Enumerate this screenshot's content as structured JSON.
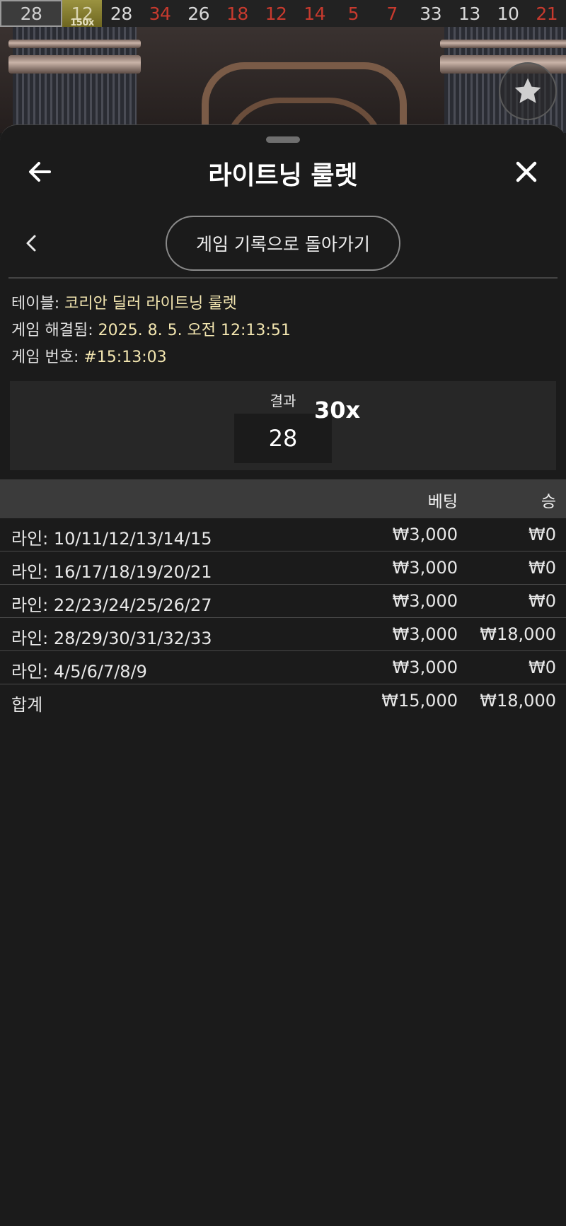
{
  "history_strip": [
    {
      "value": "28",
      "color": "gray"
    },
    {
      "value": "12",
      "color": "lightning",
      "multiplier": "150x"
    },
    {
      "value": "28",
      "color": "white"
    },
    {
      "value": "34",
      "color": "red"
    },
    {
      "value": "26",
      "color": "white"
    },
    {
      "value": "18",
      "color": "red"
    },
    {
      "value": "12",
      "color": "red"
    },
    {
      "value": "14",
      "color": "red"
    },
    {
      "value": "5",
      "color": "red"
    },
    {
      "value": "7",
      "color": "red"
    },
    {
      "value": "33",
      "color": "white"
    },
    {
      "value": "13",
      "color": "white"
    },
    {
      "value": "10",
      "color": "white"
    },
    {
      "value": "21",
      "color": "red"
    }
  ],
  "sheet": {
    "title": "라이트닝 룰렛",
    "back_to_history": "게임 기록으로 돌아가기"
  },
  "info": {
    "table_label": "테이블:",
    "table_value": "코리안 딜러 라이트닝 룰렛",
    "resolved_label": "게임 해결됨:",
    "resolved_value": "2025. 8. 5. 오전 12:13:51",
    "number_label": "게임 번호:",
    "number_value": "#15:13:03"
  },
  "result": {
    "label": "결과",
    "number": "28",
    "multiplier": "30x"
  },
  "bets": {
    "header_bet": "베팅",
    "header_win": "승",
    "rows": [
      {
        "name": "라인: 10/11/12/13/14/15",
        "bet": "₩3,000",
        "win": "₩0"
      },
      {
        "name": "라인: 16/17/18/19/20/21",
        "bet": "₩3,000",
        "win": "₩0"
      },
      {
        "name": "라인: 22/23/24/25/26/27",
        "bet": "₩3,000",
        "win": "₩0"
      },
      {
        "name": "라인: 28/29/30/31/32/33",
        "bet": "₩3,000",
        "win": "₩18,000"
      },
      {
        "name": "라인: 4/5/6/7/8/9",
        "bet": "₩3,000",
        "win": "₩0"
      }
    ],
    "total_label": "합계",
    "total_bet": "₩15,000",
    "total_win": "₩18,000"
  },
  "colors": {
    "red_number": "#c73a2e",
    "lightning_gold": "#9b9340",
    "info_value": "#f3e6b0"
  }
}
